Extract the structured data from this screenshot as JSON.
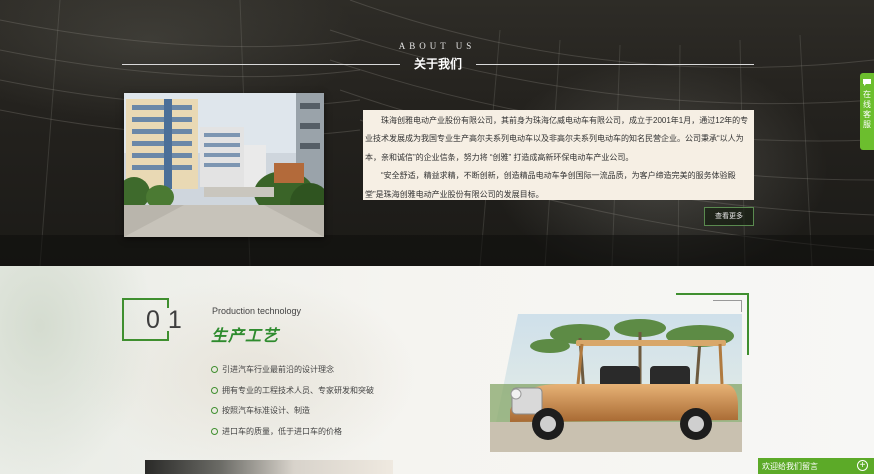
{
  "about": {
    "title_en": "ABOUT US",
    "title_cn": "关于我们",
    "paragraph1": "珠海创雅电动产业股份有限公司，其前身为珠海亿威电动车有限公司，成立于2001年1月，通过12年的专业技术发展成为我国专业生产高尔夫系列电动车以及非高尔夫系列电动车的知名民营企业。公司秉承“以人为本，亲和诚信”的企业信条，努力将 “创雅” 打造成高新环保电动车产业公司。",
    "paragraph2": "“安全舒适，精益求精，不断创新，创造精品电动车争创国际一流品质，为客户缔造完美的服务体验殿堂”是珠海创雅电动产业股份有限公司的发展目标。",
    "more_label": "查看更多"
  },
  "production": {
    "number": "01",
    "title_en": "Production technology",
    "title_cn": "生产工艺",
    "features": [
      "引进汽车行业最前沿的设计理念",
      "拥有专业的工程技术人员、专家研发和突破",
      "按照汽车标准设计、制造",
      "进口车的质量，低于进口车的价格"
    ]
  },
  "widgets": {
    "side_service_label": "在线客服",
    "message_bar_label": "欢迎给我们留言",
    "plus_symbol": "+"
  },
  "colors": {
    "accent_green": "#3f8f2f",
    "widget_green": "#6cbe2e",
    "text_box_bg": "#f6efe4"
  }
}
